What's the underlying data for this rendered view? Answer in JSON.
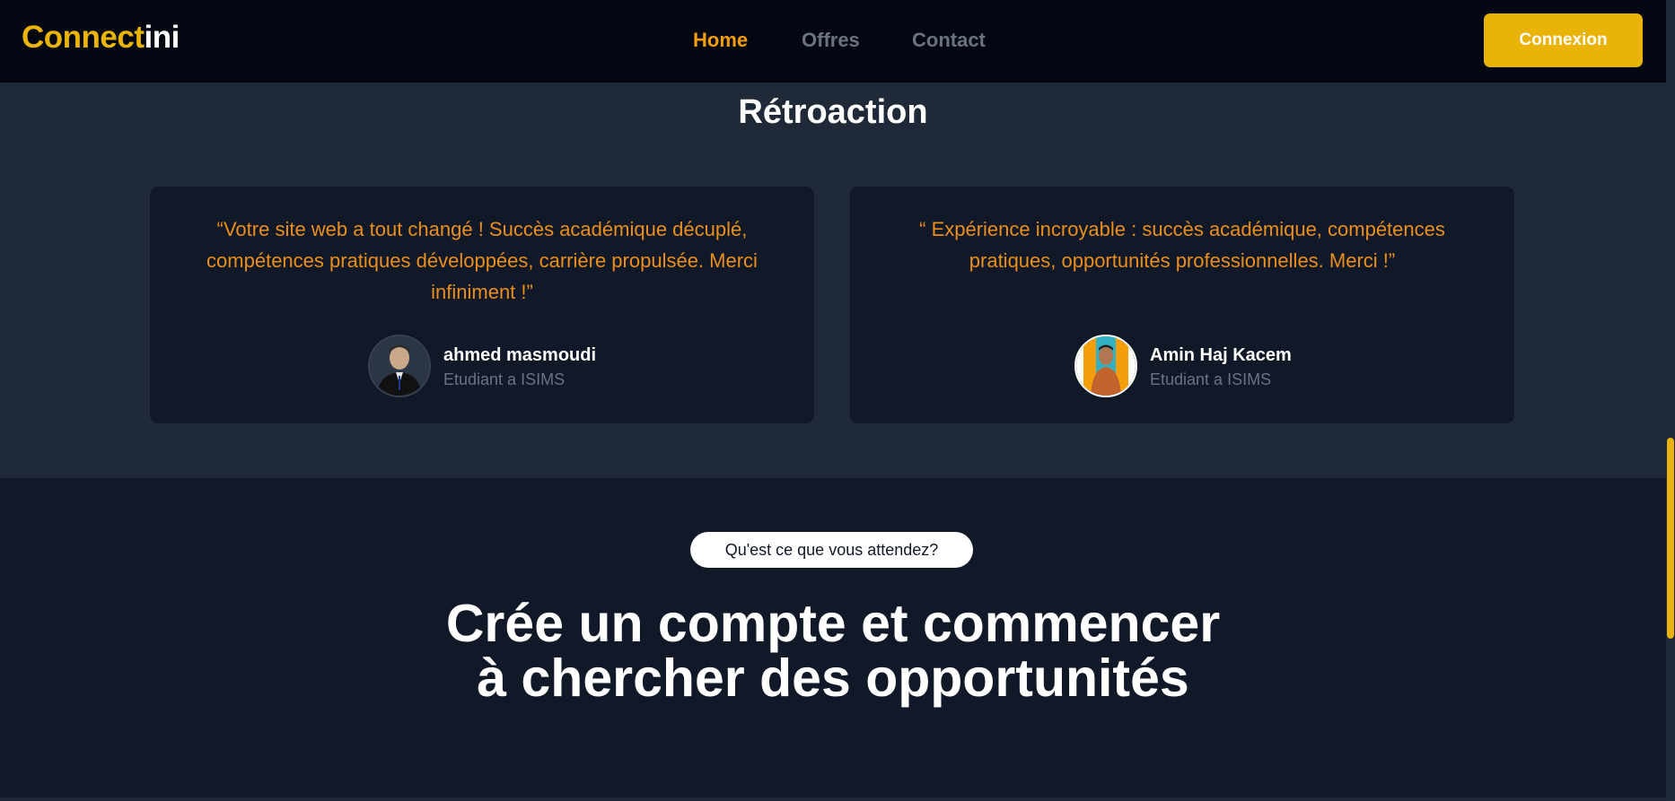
{
  "brand": {
    "name_part1": "Connect",
    "name_part2": "ini",
    "accent": "#eab308"
  },
  "nav": {
    "links": [
      {
        "label": "Home",
        "active": true
      },
      {
        "label": "Offres",
        "active": false
      },
      {
        "label": "Contact",
        "active": false
      }
    ],
    "login_label": "Connexion"
  },
  "feedback": {
    "title": "Rétroaction",
    "cards": [
      {
        "quote": "“Votre site web a tout changé ! Succès académique décuplé, compétences pratiques développées, carrière propulsée. Merci infiniment !”",
        "author": "ahmed masmoudi",
        "role": "Etudiant a ISIMS"
      },
      {
        "quote": "“ Expérience incroyable : succès académique, compétences pratiques, opportunités professionnelles. Merci !”",
        "author": "Amin Haj Kacem",
        "role": "Etudiant a ISIMS"
      }
    ]
  },
  "cta": {
    "badge": "Qu'est ce que vous attendez?",
    "headline": "Crée un compte et commencer à chercher des opportunités"
  },
  "colors": {
    "nav_bg": "#030712",
    "section_bg": "#1f2937",
    "card_bg": "#111827",
    "quote": "#ea8f1c",
    "muted": "#6b7280"
  }
}
